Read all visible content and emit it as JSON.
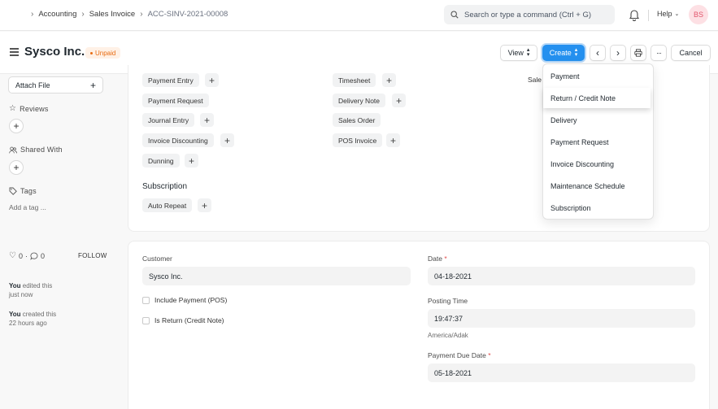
{
  "navbar": {
    "breadcrumbs": [
      "Accounting",
      "Sales Invoice",
      "ACC-SINV-2021-00008"
    ],
    "search_placeholder": "Search or type a command (Ctrl + G)",
    "help_label": "Help",
    "avatar_initials": "BS"
  },
  "pagehead": {
    "title": "Sysco Inc.",
    "status": "Unpaid",
    "view_label": "View",
    "create_label": "Create",
    "cancel_label": "Cancel"
  },
  "sidebar": {
    "attach_label": "Attach File",
    "reviews_label": "Reviews",
    "shared_label": "Shared With",
    "tags_label": "Tags",
    "add_tag": "Add a tag ...",
    "likes": "0",
    "comments": "0",
    "follow": "FOLLOW",
    "activity": [
      {
        "who": "You",
        "what": "edited this",
        "when": "just now"
      },
      {
        "who": "You",
        "what": "created this",
        "when": "22 hours ago"
      }
    ]
  },
  "connections": {
    "col1": [
      "Payment Entry",
      "Payment Request",
      "Journal Entry",
      "Invoice Discounting",
      "Dunning"
    ],
    "col2": [
      "Timesheet",
      "Delivery Note",
      "Sales Order",
      "POS Invoice"
    ],
    "col3_partial": "Sale",
    "subscription_title": "Subscription",
    "subscription_items": [
      "Auto Repeat"
    ]
  },
  "form": {
    "customer_label": "Customer",
    "customer_value": "Sysco Inc.",
    "include_payment_label": "Include Payment (POS)",
    "is_return_label": "Is Return (Credit Note)",
    "date_label": "Date",
    "date_value": "04-18-2021",
    "posting_time_label": "Posting Time",
    "posting_time_value": "19:47:37",
    "timezone": "America/Adak",
    "due_date_label": "Payment Due Date",
    "due_date_value": "05-18-2021"
  },
  "create_menu": {
    "items": [
      "Payment",
      "Return / Credit Note",
      "Delivery",
      "Payment Request",
      "Invoice Discounting",
      "Maintenance Schedule",
      "Subscription"
    ],
    "highlighted": "Return / Credit Note"
  },
  "colors": {
    "primary": "#2490ef",
    "status_text": "#e86c13",
    "status_bg": "#fff1e6",
    "avatar_bg": "#fde0e4",
    "avatar_text": "#e2566d"
  }
}
